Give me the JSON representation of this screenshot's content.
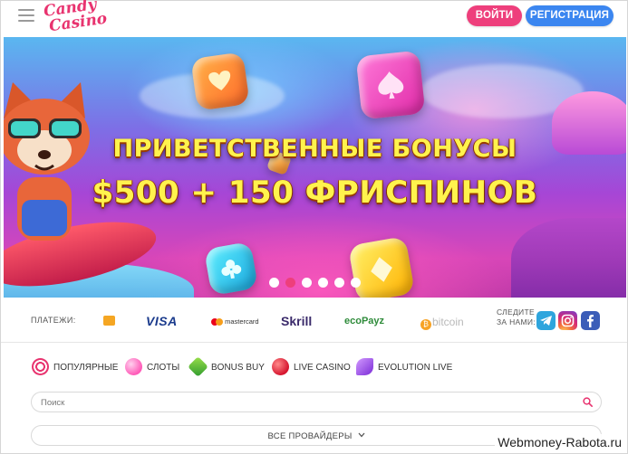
{
  "header": {
    "logo_line1": "Candy",
    "logo_line2": "Casino",
    "login_label": "ВОЙТИ",
    "register_label": "РЕГИСТРАЦИЯ"
  },
  "banner": {
    "title_line1": "ПРИВЕТСТВЕННЫЕ БОНУСЫ",
    "title_line2": "$500 + 150 ФРИСПИНОВ",
    "slides_count": 6,
    "active_slide": 2
  },
  "payments": {
    "label": "ПЛАТЕЖИ:",
    "methods": [
      "VISA",
      "mastercard",
      "Skrill",
      "ecoPayz",
      "bitcoin"
    ],
    "follow_label": "СЛЕДИТЕ ЗА НАМИ:",
    "socials": [
      "telegram",
      "instagram",
      "facebook"
    ]
  },
  "categories": [
    {
      "label": "ПОПУЛЯРНЫЕ",
      "icon": "lollipop-icon"
    },
    {
      "label": "СЛОТЫ",
      "icon": "candy-ball-icon"
    },
    {
      "label": "BONUS BUY",
      "icon": "green-gem-icon"
    },
    {
      "label": "LIVE CASINO",
      "icon": "red-candy-icon"
    },
    {
      "label": "EVOLUTION LIVE",
      "icon": "purple-candy-icon"
    }
  ],
  "search": {
    "placeholder": "Поиск",
    "value": ""
  },
  "providers": {
    "label": "ВСЕ ПРОВАЙДЕРЫ"
  },
  "watermark": "Webmoney-Rabota.ru",
  "colors": {
    "brand_pink": "#ee3f7c",
    "brand_blue": "#3b86f0",
    "banner_text": "#fff34d"
  }
}
